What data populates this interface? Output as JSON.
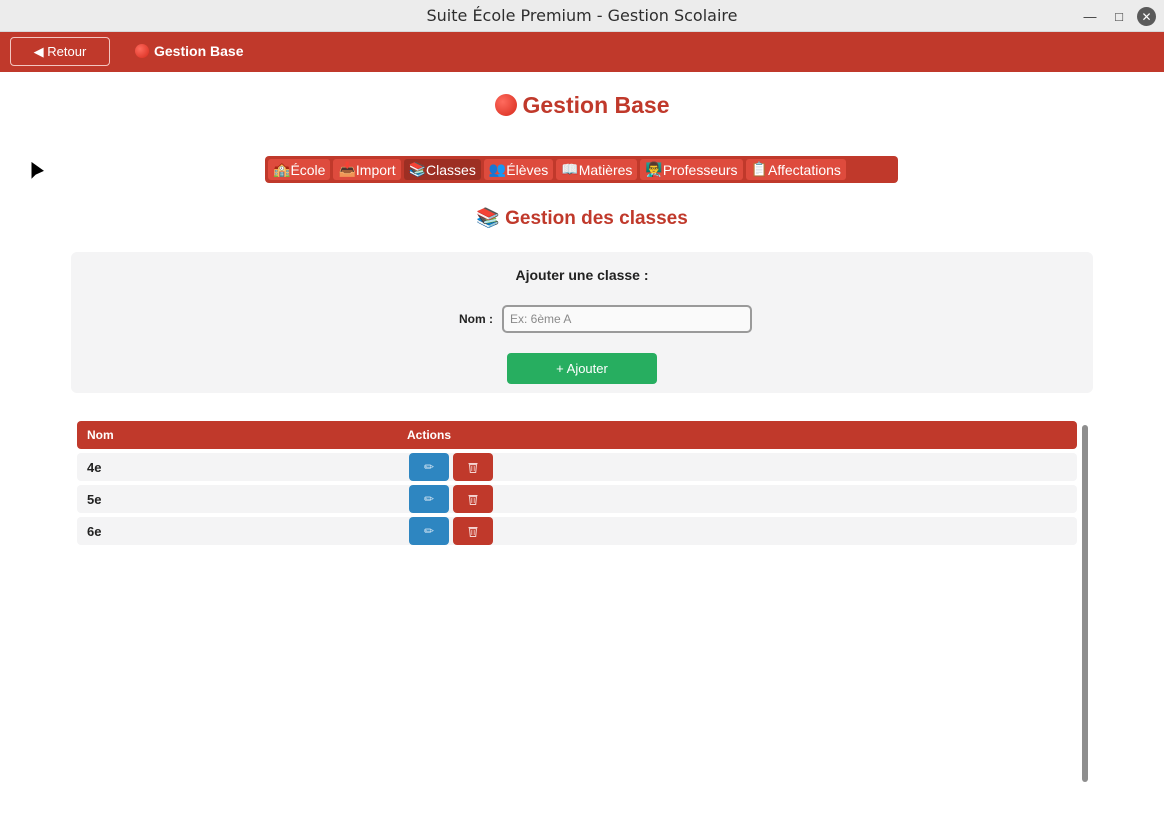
{
  "window": {
    "title": "Suite École Premium - Gestion Scolaire"
  },
  "topbar": {
    "back_label": "◀ Retour",
    "title": "Gestion Base"
  },
  "page": {
    "title": "Gestion Base"
  },
  "tabs": [
    {
      "icon": "🏫",
      "label": "École"
    },
    {
      "icon": "📥",
      "label": "Import"
    },
    {
      "icon": "📚",
      "label": "Classes"
    },
    {
      "icon": "👥",
      "label": "Élèves"
    },
    {
      "icon": "📖",
      "label": "Matières"
    },
    {
      "icon": "👨‍🏫",
      "label": "Professeurs"
    },
    {
      "icon": "📋",
      "label": "Affectations"
    }
  ],
  "section": {
    "icon": "📚",
    "title": "Gestion des classes"
  },
  "form": {
    "heading": "Ajouter une classe :",
    "name_label": "Nom :",
    "name_placeholder": "Ex: 6ème A",
    "add_label": "+ Ajouter"
  },
  "table": {
    "headers": {
      "name": "Nom",
      "actions": "Actions"
    },
    "rows": [
      {
        "name": "4e"
      },
      {
        "name": "5e"
      },
      {
        "name": "6e"
      }
    ],
    "edit_icon": "pencil-icon",
    "delete_icon": "trash-icon"
  },
  "colors": {
    "primary": "#c0392b",
    "success": "#27ae60",
    "info": "#2e86c1"
  }
}
